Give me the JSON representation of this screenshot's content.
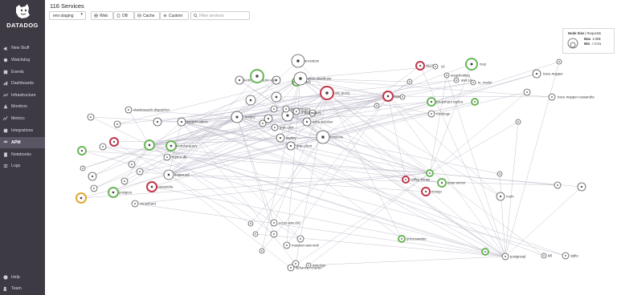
{
  "app": {
    "brand": "DATADOG"
  },
  "page": {
    "title": "116 Services"
  },
  "toolbar": {
    "env_value": "env:staging",
    "filters": [
      {
        "label": "Web",
        "icon": "globe-icon"
      },
      {
        "label": "DB",
        "icon": "database-icon"
      },
      {
        "label": "Cache",
        "icon": "cache-icon"
      },
      {
        "label": "Custom",
        "icon": "gear-icon"
      }
    ],
    "search_placeholder": "Filter services"
  },
  "sidebar": {
    "items": [
      {
        "label": "New Stuff",
        "icon": "megaphone-icon"
      },
      {
        "label": "Watchdog",
        "icon": "watchdog-icon"
      },
      {
        "label": "Events",
        "icon": "events-icon"
      },
      {
        "label": "Dashboards",
        "icon": "dashboard-icon"
      },
      {
        "label": "Infrastructure",
        "icon": "infrastructure-icon"
      },
      {
        "label": "Monitors",
        "icon": "monitor-icon"
      },
      {
        "label": "Metrics",
        "icon": "metrics-icon"
      },
      {
        "label": "Integrations",
        "icon": "puzzle-icon"
      },
      {
        "label": "APM",
        "icon": "apm-icon",
        "active": true
      },
      {
        "label": "Notebooks",
        "icon": "notebook-icon"
      },
      {
        "label": "Logs",
        "icon": "logs-icon"
      }
    ],
    "bottom": [
      {
        "label": "Help",
        "icon": "help-icon"
      },
      {
        "label": "Team",
        "icon": "team-icon"
      }
    ]
  },
  "legend": {
    "title": "Node Size",
    "separator": "|",
    "metric": "Requests",
    "max_label": "Max",
    "max_value": "2.08k",
    "min_label": "Min",
    "min_value": "< 0.01"
  },
  "colors": {
    "sidebar": "#3d3a44",
    "healthy": "#6cb65b",
    "critical": "#c0374a",
    "warning": "#e0a830",
    "neutral": "#555555",
    "edge": "#b7b3c4"
  },
  "service_labels": [
    "ancestors",
    "rspec",
    "alerting-scheduler-web",
    "paniers-web",
    "slicer-distributor",
    "cta_query",
    "resque",
    "support-admin",
    "elasticsearch-dispatcher",
    "elasticsearch",
    "authenticator",
    "grpc-client",
    "grpc-user",
    "logdev",
    "mousone",
    "grpc-stan",
    "trace-resolver",
    "scarr-query",
    "ingest",
    "resque-web",
    "mongo-pipeline",
    "snapshotting",
    "rtb13",
    "s3",
    "rsvp",
    "aws.s3",
    "ts_model",
    "cta-pshard replica",
    "memlogs",
    "trace-mapper",
    "trace-mapper-cassandra",
    "replica-db",
    "dogsound",
    "cassandra",
    "postgres",
    "cta-pshard",
    "coffee-house",
    "bean-server",
    "mongo",
    "room",
    "eccer-aws.ds2",
    "maesser-aws-web",
    "dehancer-crawler",
    "aws.logs",
    "processwriter",
    "postgresql",
    "kill",
    "sqlite",
    "munchy-query",
    "pnp",
    "datadog-web",
    "sidekiq",
    "redis",
    "gunicorn"
  ]
}
